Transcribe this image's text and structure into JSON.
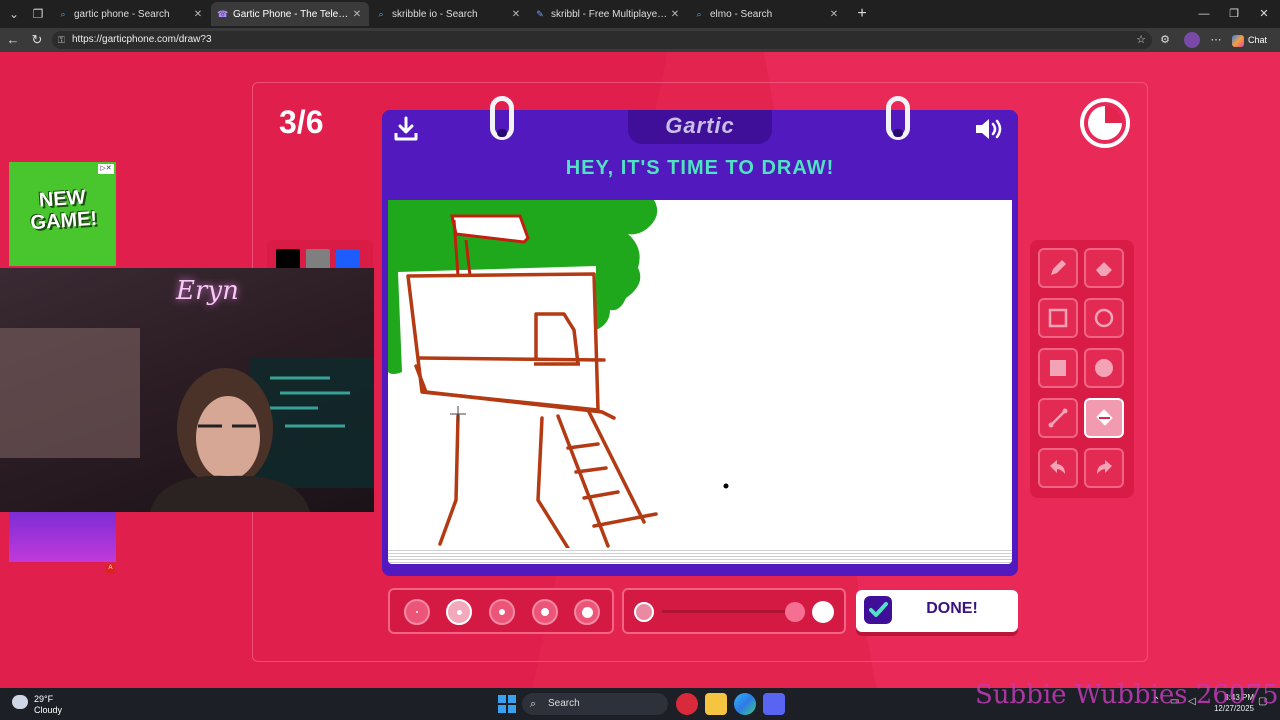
{
  "browser": {
    "tabs": [
      {
        "title": "gartic phone - Search",
        "icon": "search-favicon",
        "active": false
      },
      {
        "title": "Gartic Phone - The Telephone Game",
        "icon": "gartic-favicon",
        "active": true
      },
      {
        "title": "skribble io - Search",
        "icon": "search-favicon",
        "active": false
      },
      {
        "title": "skribbl - Free Multiplayer Drawing",
        "icon": "skribbl-favicon",
        "active": false
      },
      {
        "title": "elmo - Search",
        "icon": "search-favicon",
        "active": false
      }
    ],
    "url": "https://garticphone.com/draw?3",
    "chat_label": "Chat"
  },
  "game": {
    "counter": "3/6",
    "logo": "Gartic",
    "title": "HEY, IT'S TIME TO DRAW!",
    "done_label": "DONE!",
    "colors": [
      "#000000",
      "#7f7f7f",
      "#1d5cff"
    ],
    "tools": [
      "pencil",
      "eraser",
      "rectangle-outline",
      "ellipse-outline",
      "rectangle-fill",
      "ellipse-fill",
      "line",
      "fill-bucket",
      "undo",
      "redo"
    ],
    "selected_tool": "fill-bucket",
    "brush_sizes": 5,
    "selected_size": 2
  },
  "overlays": {
    "ad_text_line1": "NEW",
    "ad_text_line2": "GAME!",
    "webcam_neon": "Eryn",
    "watermark": "Subbie Wubbies 26075"
  },
  "taskbar": {
    "temperature": "29°F",
    "condition": "Cloudy",
    "search_label": "Search",
    "time": "8:43 PM",
    "date": "12/27/2025"
  }
}
